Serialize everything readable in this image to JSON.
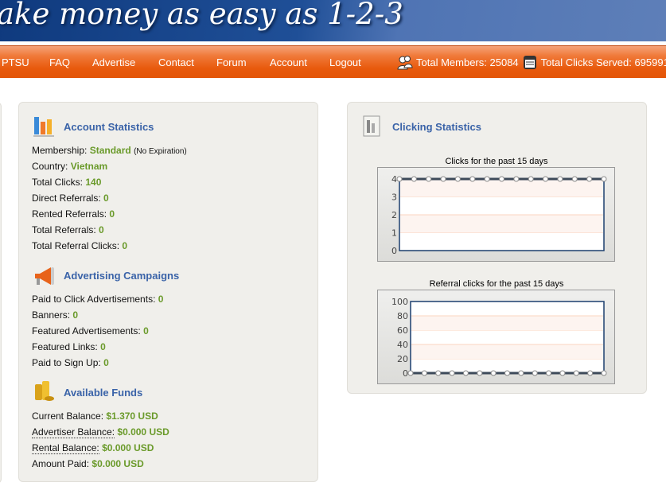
{
  "header": {
    "slogan": "ake money as easy as 1-2-3"
  },
  "nav": {
    "items": [
      "PTSU",
      "FAQ",
      "Advertise",
      "Contact",
      "Forum",
      "Account",
      "Logout"
    ],
    "total_members_label": "Total Members:",
    "total_members": "25084",
    "total_clicks_label": "Total Clicks Served:",
    "total_clicks": "695991"
  },
  "account": {
    "title": "Account Statistics",
    "membership_label": "Membership:",
    "membership": "Standard",
    "expiration": "(No Expiration)",
    "country_label": "Country:",
    "country": "Vietnam",
    "total_clicks_label": "Total Clicks:",
    "total_clicks": "140",
    "direct_label": "Direct Referrals:",
    "direct": "0",
    "rented_label": "Rented Referrals:",
    "rented": "0",
    "total_ref_label": "Total Referrals:",
    "total_ref": "0",
    "ref_clicks_label": "Total Referral Clicks:",
    "ref_clicks": "0"
  },
  "campaigns": {
    "title": "Advertising Campaigns",
    "ptc_label": "Paid to Click Advertisements:",
    "ptc": "0",
    "banners_label": "Banners:",
    "banners": "0",
    "featured_label": "Featured Advertisements:",
    "featured": "0",
    "links_label": "Featured Links:",
    "links": "0",
    "ptsu_label": "Paid to Sign Up:",
    "ptsu": "0"
  },
  "funds": {
    "title": "Available Funds",
    "current_label": "Current Balance:",
    "current": "$1.370 USD",
    "advertiser_label": "Advertiser Balance:",
    "advertiser": "$0.000 USD",
    "rental_label": "Rental Balance:",
    "rental": "$0.000 USD",
    "paid_label": "Amount Paid:",
    "paid": "$0.000 USD"
  },
  "clicking": {
    "title": "Clicking Statistics"
  },
  "chart_data": [
    {
      "type": "line",
      "title": "Clicks for the past 15 days",
      "ylim": [
        0,
        4
      ],
      "yticks": [
        "0",
        "1",
        "2",
        "3",
        "4"
      ],
      "values": [
        4,
        4,
        4,
        4,
        4,
        4,
        4,
        4,
        4,
        4,
        4,
        4,
        4,
        4,
        4
      ],
      "grid": true,
      "line_color": "#3d4a5a"
    },
    {
      "type": "line",
      "title": "Referral clicks for the past 15 days",
      "ylim": [
        0,
        100
      ],
      "yticks": [
        "0",
        "20",
        "40",
        "60",
        "80",
        "100"
      ],
      "values": [
        0,
        0,
        0,
        0,
        0,
        0,
        0,
        0,
        0,
        0,
        0,
        0,
        0,
        0,
        0
      ],
      "grid": true,
      "line_color": "#3d4a5a"
    }
  ]
}
